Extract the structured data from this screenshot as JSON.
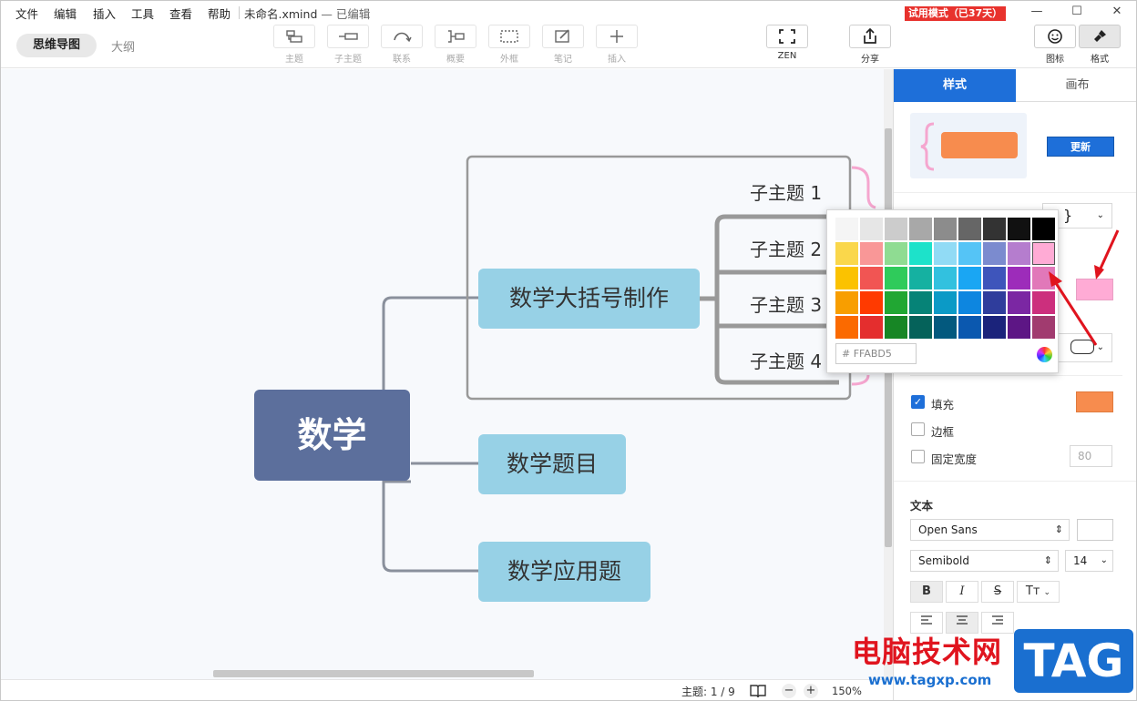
{
  "menu": [
    "文件",
    "编辑",
    "插入",
    "工具",
    "查看",
    "帮助"
  ],
  "doc_title": "未命名.xmind",
  "doc_status": "— 已编辑",
  "trial": "试用模式（已37天）",
  "window": {
    "min": "—",
    "max": "☐",
    "close": "✕"
  },
  "view_tabs": {
    "mindmap": "思维导图",
    "outline": "大纲"
  },
  "tools": {
    "topic": "主题",
    "subtopic": "子主题",
    "relation": "联系",
    "summary": "概要",
    "boundary": "外框",
    "note": "笔记",
    "insert": "插入",
    "zen": "ZEN",
    "share": "分享",
    "icon": "图标",
    "format": "格式"
  },
  "map": {
    "central": "数学",
    "main1": "数学大括号制作",
    "main2": "数学题目",
    "main3": "数学应用题",
    "subs": [
      "子主题 1",
      "子主题 2",
      "子主题 3",
      "子主题 4"
    ]
  },
  "status": {
    "topic_count": "主题: 1 / 9",
    "zoom": "150%",
    "minus": "−",
    "plus": "+"
  },
  "panel": {
    "tab_style": "样式",
    "tab_canvas": "画布",
    "update": "更新",
    "fill": "填充",
    "border": "边框",
    "fixed_width": "固定宽度",
    "fixed_width_value": "80",
    "text_section": "文本",
    "font": "Open Sans",
    "weight": "Semibold",
    "size": "14",
    "bold": "B",
    "italic": "I",
    "strike": "S",
    "case": "Tт",
    "fill_color": "#F78C4E",
    "accent": "#1E6FD9",
    "selected_color": "#FFABD5"
  },
  "color_popup": {
    "hex_prefix": "#",
    "hex_value": "FFABD5",
    "rows": [
      [
        "#F5F5F5",
        "#E6E6E6",
        "#CCCCCC",
        "#A8A8A8",
        "#8C8C8C",
        "#666666",
        "#333333",
        "#111111",
        "#000000"
      ],
      [
        "#FAD74B",
        "#F99797",
        "#8FDC92",
        "#1DE2CA",
        "#91DBF5",
        "#55C4F6",
        "#7B8BCF",
        "#B57DCE",
        "#FFABD5"
      ],
      [
        "#FBC200",
        "#F15553",
        "#2FCB5B",
        "#15B1A1",
        "#32C1DF",
        "#1AA6F3",
        "#3E55BB",
        "#9D2CBA",
        "#E178B9"
      ],
      [
        "#F89E00",
        "#FF3A00",
        "#21A733",
        "#068377",
        "#0B9AC6",
        "#0D86E0",
        "#2F3D9C",
        "#7B27A3",
        "#CC2F7D"
      ],
      [
        "#FB6A00",
        "#E42E2E",
        "#178625",
        "#05625A",
        "#03597E",
        "#0B58AF",
        "#1B237B",
        "#5D1685",
        "#A13B6F"
      ]
    ]
  },
  "watermark": {
    "text": "电脑技术网",
    "url": "www.tagxp.com",
    "logo": "TAG"
  }
}
